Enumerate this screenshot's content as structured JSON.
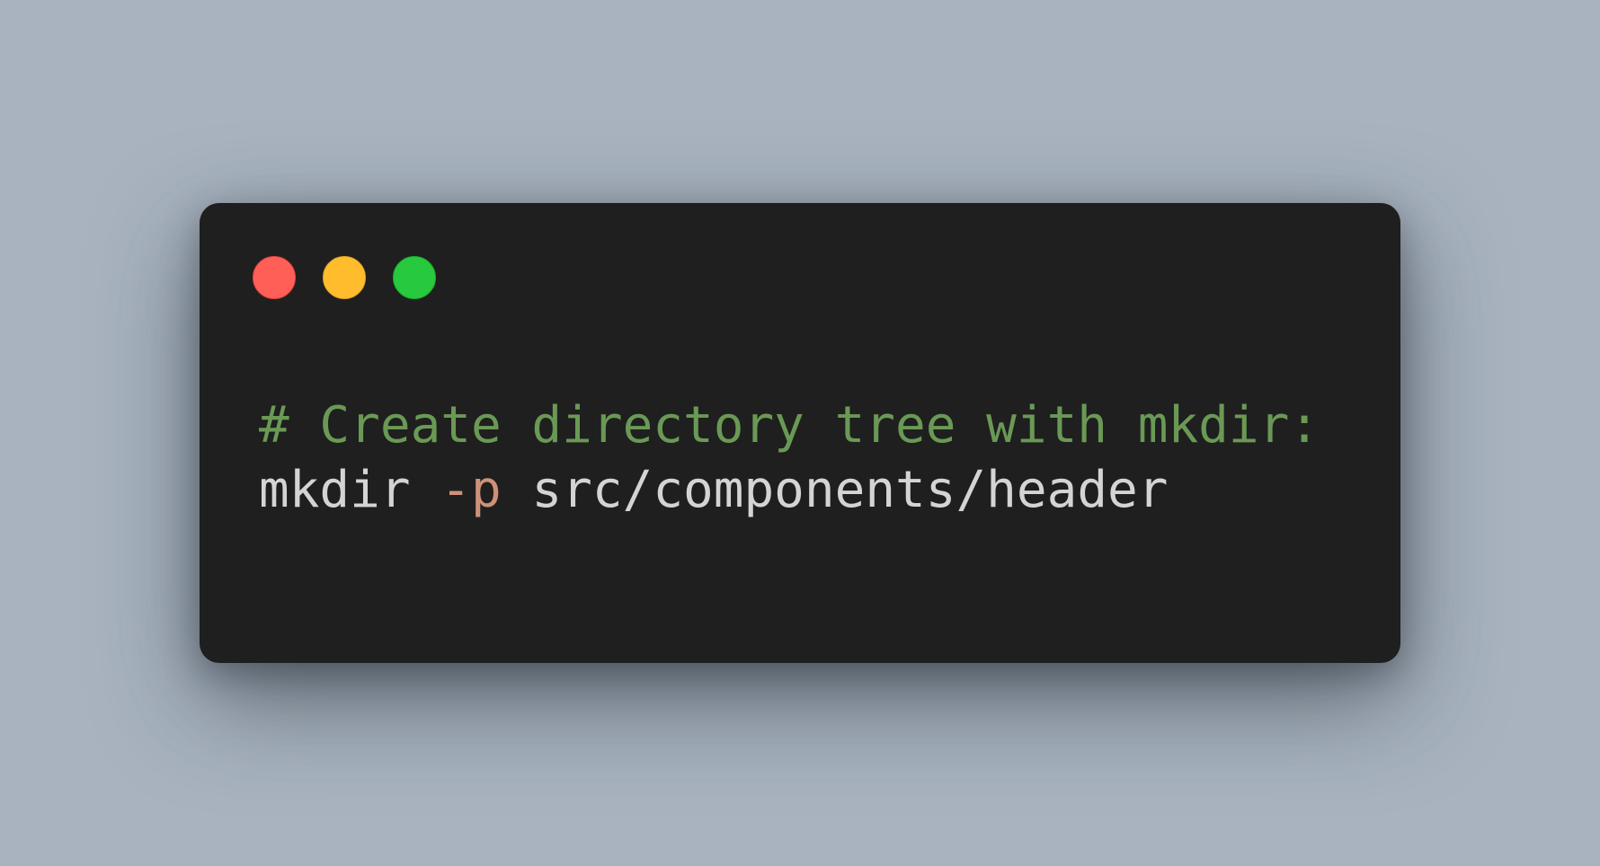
{
  "window": {
    "controls": [
      {
        "name": "close-button",
        "color": "#ff5f56"
      },
      {
        "name": "minimize-button",
        "color": "#ffbd2e"
      },
      {
        "name": "maximize-button",
        "color": "#27c93f"
      }
    ]
  },
  "code": {
    "comment": "# Create directory tree with mkdir:",
    "command": "mkdir",
    "flag": "-p",
    "path": "src/components/header"
  },
  "colors": {
    "background": "#a8b3bf",
    "window": "#1f1f1f",
    "comment": "#6a9955",
    "flag": "#ce9178",
    "text": "#d4d4d4"
  }
}
